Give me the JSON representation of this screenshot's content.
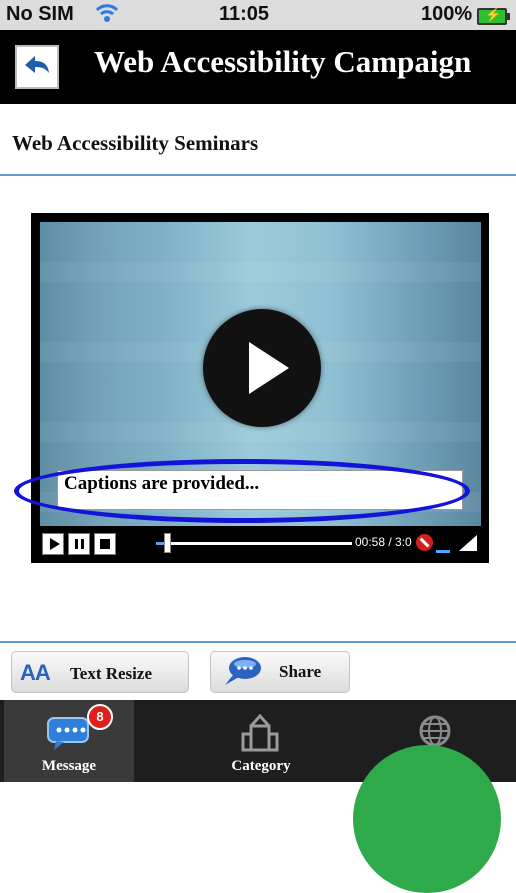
{
  "status_bar": {
    "carrier": "No SIM",
    "time": "11:05",
    "battery": "100%"
  },
  "header": {
    "title": "Web Accessibility Campaign",
    "back_icon": "back-arrow-icon"
  },
  "page": {
    "title": "Web Accessibility Seminars"
  },
  "video": {
    "caption": "Captions are provided...",
    "time_readout": "00:58 / 3:0",
    "progress": 0.04,
    "controls": [
      "play-icon",
      "pause-icon",
      "stop-icon"
    ]
  },
  "actions": {
    "text_resize_icon": "AA",
    "text_resize_label": "Text Resize",
    "share_label": "Share"
  },
  "tabbar": {
    "tabs": [
      {
        "label": "Message",
        "icon": "message-icon",
        "badge": "8",
        "active": true
      },
      {
        "label": "Category",
        "icon": "category-icon",
        "active": false
      },
      {
        "label": "",
        "icon": "globe-icon",
        "active": false
      }
    ]
  },
  "colors": {
    "accent_rule": "#5b9bd5",
    "caption_highlight": "#1414d8",
    "badge": "#e01e1e",
    "overlay_circle": "#2eaa4a"
  }
}
